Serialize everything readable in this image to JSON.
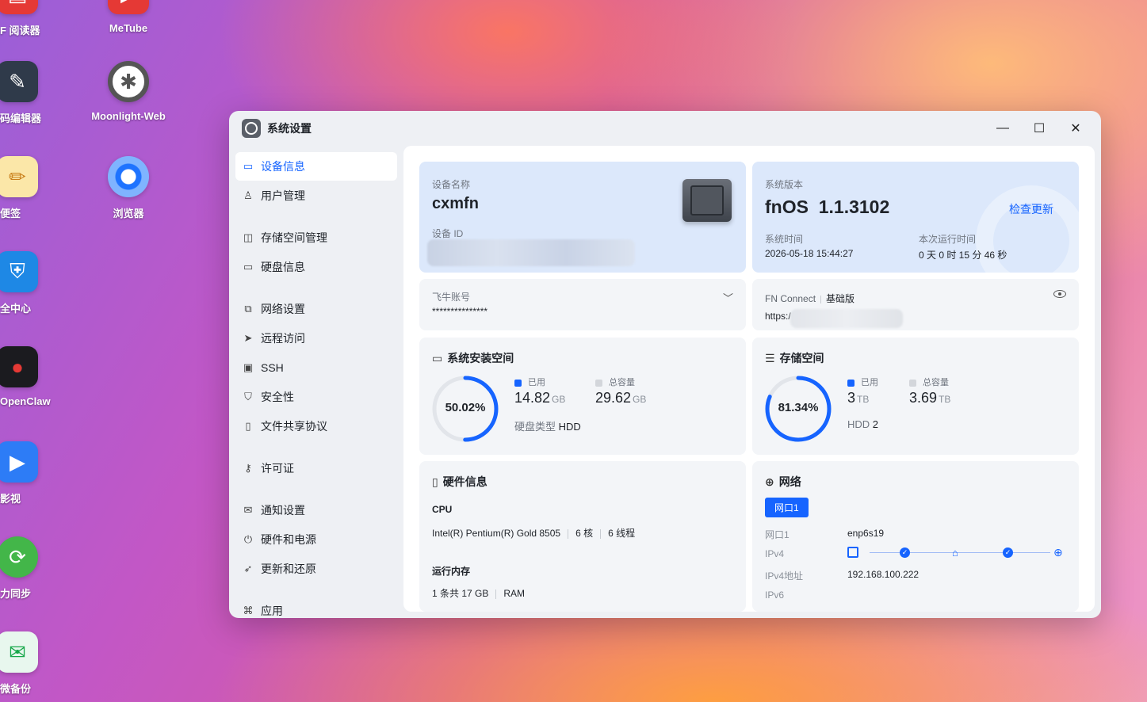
{
  "desktop": {
    "icons": [
      {
        "label": "F 阅读器"
      },
      {
        "label": "码编辑器"
      },
      {
        "label": "便签"
      },
      {
        "label": "全中心"
      },
      {
        "label": "OpenClaw"
      },
      {
        "label": "影视"
      },
      {
        "label": "力同步"
      },
      {
        "label": "微备份"
      },
      {
        "label": "MeTube"
      },
      {
        "label": "Moonlight-Web"
      },
      {
        "label": "浏览器"
      }
    ]
  },
  "window": {
    "title": "系统设置",
    "controls": {
      "minimize": "—",
      "maximize": "☐",
      "close": "✕"
    }
  },
  "sidebar": {
    "items": [
      {
        "label": "设备信息"
      },
      {
        "label": "用户管理"
      },
      {
        "label": "存储空间管理"
      },
      {
        "label": "硬盘信息"
      },
      {
        "label": "网络设置"
      },
      {
        "label": "远程访问"
      },
      {
        "label": "SSH"
      },
      {
        "label": "安全性"
      },
      {
        "label": "文件共享协议"
      },
      {
        "label": "许可证"
      },
      {
        "label": "通知设置"
      },
      {
        "label": "硬件和电源"
      },
      {
        "label": "更新和还原"
      },
      {
        "label": "应用"
      }
    ]
  },
  "device": {
    "name_label": "设备名称",
    "name": "cxmfn",
    "id_label": "设备 ID"
  },
  "system": {
    "version_label": "系统版本",
    "version": "fnOS  1.1.3102",
    "check_update": "检查更新",
    "time_label": "系统时间",
    "time": "2026-05-18 15:44:27",
    "uptime_label": "本次运行时间",
    "uptime": "0 天 0 时 15 分 46 秒"
  },
  "account": {
    "label": "飞牛账号",
    "value": "***************"
  },
  "fnconnect": {
    "label": "FN Connect",
    "tier": "基础版",
    "url_prefix": "https:/"
  },
  "sys_space": {
    "title": "系统安装空间",
    "percent": "50.02%",
    "percent_value": 50.02,
    "used_label": "已用",
    "used": "14.82",
    "used_unit": "GB",
    "total_label": "总容量",
    "total": "29.62",
    "total_unit": "GB",
    "disk_type_label": "硬盘类型",
    "disk_type": "HDD"
  },
  "storage": {
    "title": "存储空间",
    "percent": "81.34%",
    "percent_value": 81.34,
    "used_label": "已用",
    "used": "3",
    "used_unit": "TB",
    "total_label": "总容量",
    "total": "3.69",
    "total_unit": "TB",
    "disk_label": "HDD",
    "disk_count": "2"
  },
  "hardware": {
    "title": "硬件信息",
    "cpu_label": "CPU",
    "cpu_model": "Intel(R) Pentium(R) Gold 8505",
    "cores": "6 核",
    "threads": "6 线程",
    "ram_label": "运行内存",
    "ram_slots": "1 条共 17 GB",
    "ram_type": "RAM"
  },
  "network": {
    "title": "网络",
    "port_tab": "网口1",
    "port_label": "网口1",
    "port_value": "enp6s19",
    "ipv4_label": "IPv4",
    "ipv4_addr_label": "IPv4地址",
    "ipv4_addr": "192.168.100.222",
    "ipv6_label": "IPv6"
  },
  "colors": {
    "accent": "#1664ff",
    "ring_track": "#e2e5ea"
  }
}
